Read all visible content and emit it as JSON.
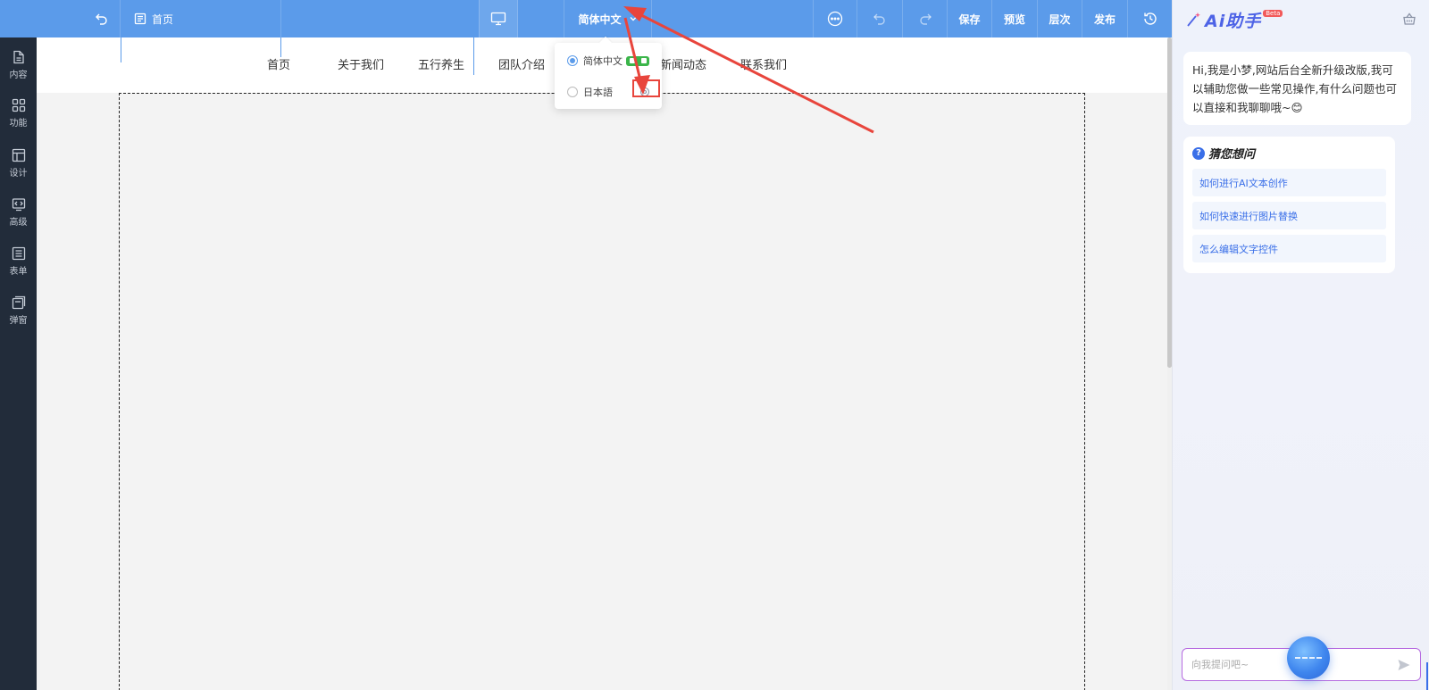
{
  "topbar": {
    "page_name": "首页",
    "language": "简体中文",
    "save_label": "保存",
    "preview_label": "预览",
    "layers_label": "层次",
    "publish_label": "发布"
  },
  "sidebar": {
    "items": [
      {
        "label": "内容",
        "icon": "file-icon"
      },
      {
        "label": "功能",
        "icon": "grid-icon"
      },
      {
        "label": "设计",
        "icon": "layout-icon"
      },
      {
        "label": "高级",
        "icon": "code-icon"
      },
      {
        "label": "表单",
        "icon": "list-icon"
      },
      {
        "label": "弹窗",
        "icon": "popup-icon"
      }
    ]
  },
  "site_nav": {
    "items": [
      "首页",
      "关于我们",
      "五行养生",
      "团队介绍",
      "新闻动态",
      "联系我们"
    ]
  },
  "lang_dropdown": {
    "options": [
      {
        "label": "简体中文",
        "selected": true
      },
      {
        "label": "日本語",
        "selected": false
      }
    ]
  },
  "ai_panel": {
    "logo_text": "Ai助手",
    "beta_label": "Beta",
    "greeting": "Hi,我是小梦,网站后台全新升级改版,我可以辅助您做一些常见操作,有什么问题也可以直接和我聊聊哦~😊",
    "guess_title": "猜您想问",
    "suggestions": [
      "如何进行AI文本创作",
      "如何快速进行图片替换",
      "怎么编辑文字控件"
    ],
    "input_placeholder": "向我提问吧~"
  },
  "colors": {
    "topbar": "#5b9bea",
    "sidebar": "#222c3a",
    "annotation": "#e8453c",
    "accent": "#3a6fe8"
  }
}
